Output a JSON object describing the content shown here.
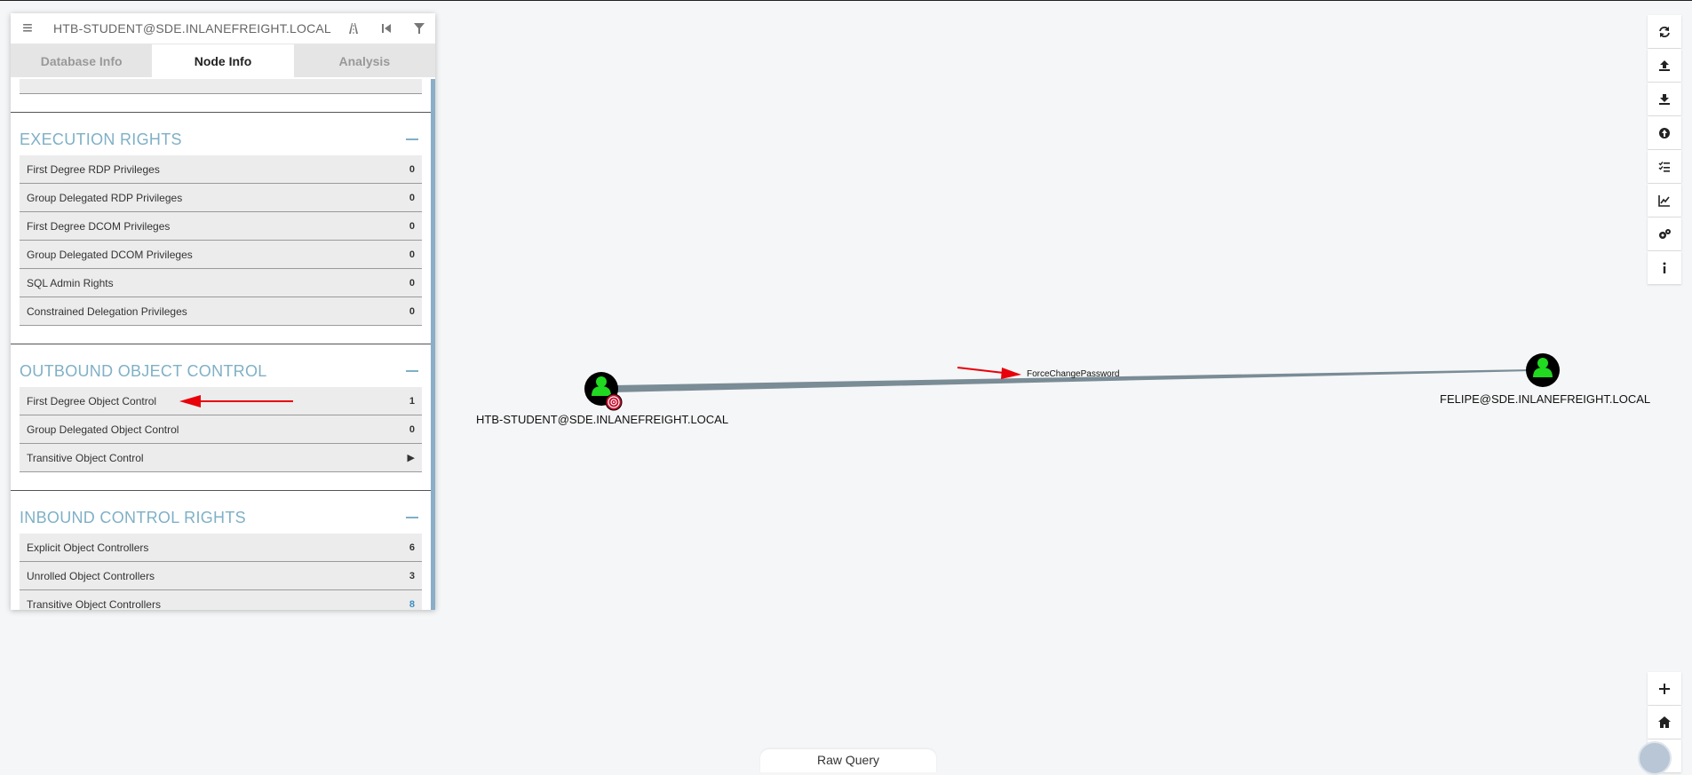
{
  "search": {
    "query": "HTB-STUDENT@SDE.INLANEFREIGHT.LOCAL"
  },
  "tabs": [
    {
      "label": "Database Info"
    },
    {
      "label": "Node Info"
    },
    {
      "label": "Analysis"
    }
  ],
  "sections": {
    "execution": {
      "title": "EXECUTION RIGHTS",
      "rows": [
        {
          "label": "First Degree RDP Privileges",
          "value": "0"
        },
        {
          "label": "Group Delegated RDP Privileges",
          "value": "0"
        },
        {
          "label": "First Degree DCOM Privileges",
          "value": "0"
        },
        {
          "label": "Group Delegated DCOM Privileges",
          "value": "0"
        },
        {
          "label": "SQL Admin Rights",
          "value": "0"
        },
        {
          "label": "Constrained Delegation Privileges",
          "value": "0"
        }
      ]
    },
    "outbound": {
      "title": "OUTBOUND OBJECT CONTROL",
      "rows": [
        {
          "label": "First Degree Object Control",
          "value": "1"
        },
        {
          "label": "Group Delegated Object Control",
          "value": "0"
        },
        {
          "label": "Transitive Object Control",
          "value": "▶"
        }
      ]
    },
    "inbound": {
      "title": "INBOUND CONTROL RIGHTS",
      "rows": [
        {
          "label": "Explicit Object Controllers",
          "value": "6"
        },
        {
          "label": "Unrolled Object Controllers",
          "value": "3"
        },
        {
          "label": "Transitive Object Controllers",
          "value": "8"
        }
      ]
    }
  },
  "graph": {
    "source_node": "HTB-STUDENT@SDE.INLANEFREIGHT.LOCAL",
    "target_node": "FELIPE@SDE.INLANEFREIGHT.LOCAL",
    "edge_label": "ForceChangePassword"
  },
  "right_toolbar": [
    "refresh-icon",
    "upload-icon",
    "download-icon",
    "arrow-up-circle-icon",
    "checklist-icon",
    "chart-line-icon",
    "gears-icon",
    "info-icon"
  ],
  "zoom_controls": [
    "zoom-in-icon",
    "home-icon",
    "zoom-out-icon"
  ],
  "raw_query": {
    "label": "Raw Query"
  },
  "colors": {
    "accent": "#7fb0c6",
    "node_green": "#21d921",
    "annotation_arrow": "#e8000b",
    "edge": "#7a8c96"
  }
}
